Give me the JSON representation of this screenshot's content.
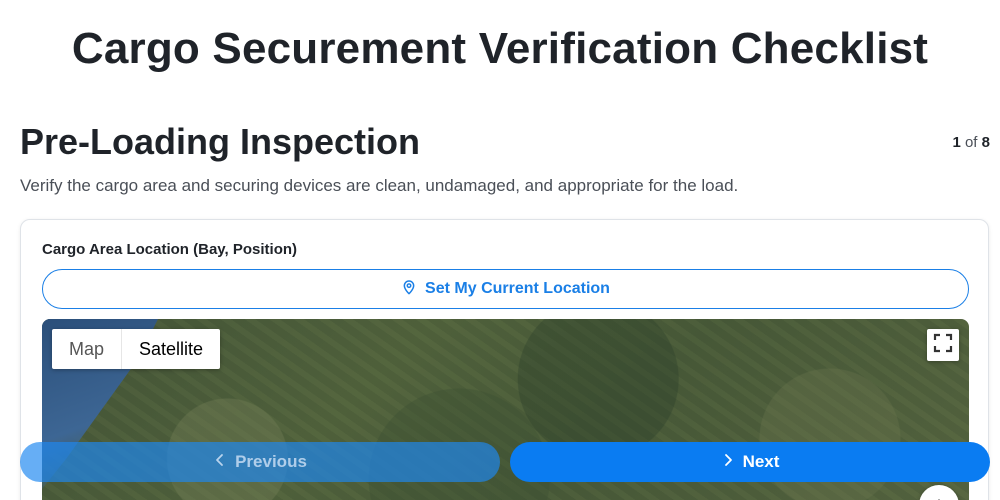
{
  "page": {
    "title": "Cargo Securement Verification Checklist"
  },
  "section": {
    "title": "Pre-Loading Inspection",
    "description": "Verify the cargo area and securing devices are clean, undamaged, and appropriate for the load.",
    "step_current": "1",
    "step_separator": "of",
    "step_total": "8"
  },
  "location_field": {
    "label": "Cargo Area Location (Bay, Position)",
    "button_label": "Set My Current Location",
    "icon": "map-pin-icon"
  },
  "map": {
    "type_options": [
      "Map",
      "Satellite"
    ],
    "selected_type": "Satellite",
    "fullscreen_icon": "fullscreen-icon"
  },
  "navigation": {
    "previous_label": "Previous",
    "next_label": "Next"
  },
  "colors": {
    "accent": "#0a7cf2",
    "text": "#1f2329"
  }
}
